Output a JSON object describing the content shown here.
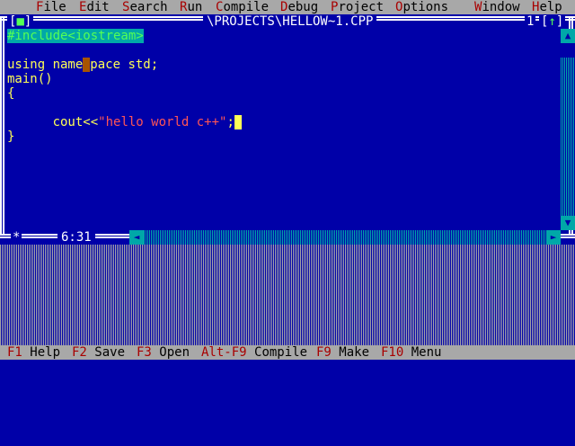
{
  "menu": {
    "system": "≡",
    "items": [
      {
        "hot": "F",
        "rest": "ile"
      },
      {
        "hot": "E",
        "rest": "dit"
      },
      {
        "hot": "S",
        "rest": "earch"
      },
      {
        "hot": "R",
        "rest": "un"
      },
      {
        "hot": "C",
        "rest": "ompile"
      },
      {
        "hot": "D",
        "rest": "ebug"
      },
      {
        "hot": "P",
        "rest": "roject"
      },
      {
        "hot": "O",
        "rest": "ptions"
      },
      {
        "hot": "W",
        "rest": "indow"
      },
      {
        "hot": "H",
        "rest": "elp"
      }
    ]
  },
  "window": {
    "close_left": "[",
    "close_mark": "■",
    "close_right": "]",
    "title": "\\PROJECTS\\HELLOW~1.CPP",
    "number": "1",
    "zoom_left": "[",
    "zoom_arrow": "↑",
    "zoom_right": "]",
    "modified_marker": "*",
    "cursor_position": "6:31"
  },
  "code": {
    "line1": "#include<iostream>",
    "line3_a": "using name",
    "line3_b": "pace std;",
    "line4": "main()",
    "line5": "{",
    "line6_a": "      cout<<",
    "line6_str": "\"hello world c++\"",
    "line6_b": ";",
    "line7": "}"
  },
  "scrollbars": {
    "up_arrow": "▲",
    "down_arrow": "▼",
    "left_arrow": "◄",
    "right_arrow": "►"
  },
  "fkeys": [
    {
      "key": "F1",
      "label": "Help"
    },
    {
      "key": "F2",
      "label": "Save"
    },
    {
      "key": "F3",
      "label": "Open"
    },
    {
      "key": "Alt-F9",
      "label": "Compile"
    },
    {
      "key": "F9",
      "label": "Make"
    },
    {
      "key": "F10",
      "label": "Menu"
    }
  ],
  "colors": {
    "background": "#0000a8",
    "menu_bar": "#a8a8a8",
    "hotkey": "#a80000",
    "code_text": "#ffff55",
    "string_literal": "#ff5555",
    "preprocessor_bg": "#00a8a8",
    "frame": "#ffffff"
  }
}
